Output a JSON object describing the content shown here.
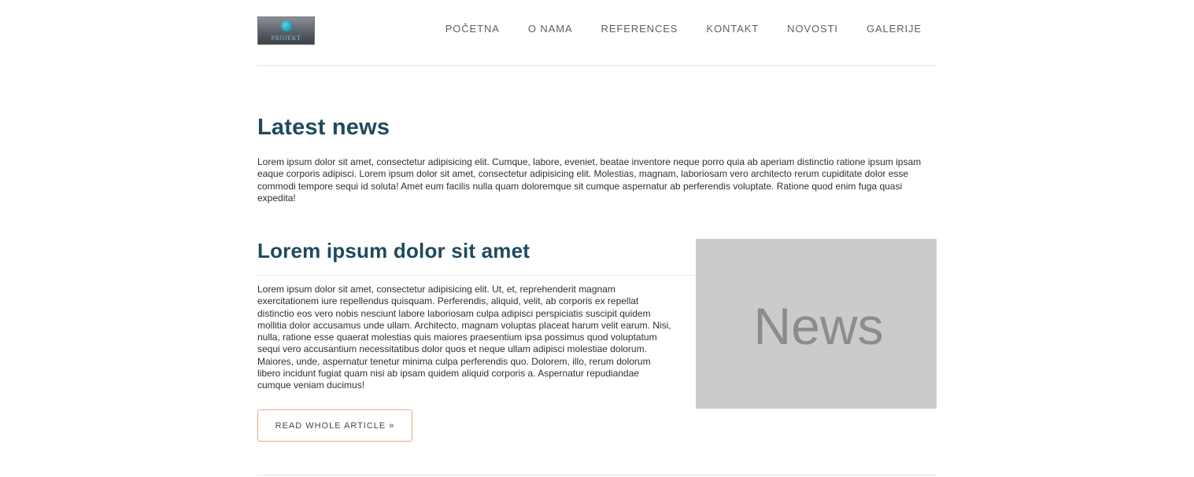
{
  "header": {
    "logo_text": "PROJEKT",
    "nav": [
      {
        "label": "POČETNA"
      },
      {
        "label": "O NAMA"
      },
      {
        "label": "REFERENCES"
      },
      {
        "label": "KONTAKT"
      },
      {
        "label": "NOVOSTI"
      },
      {
        "label": "GALERIJE"
      }
    ]
  },
  "latest": {
    "title": "Latest news",
    "intro": "Lorem ipsum dolor sit amet, consectetur adipisicing elit. Cumque, labore, eveniet, beatae inventore neque porro quia ab aperiam distinctio ratione ipsum ipsam eaque corporis adipisci. Lorem ipsum dolor sit amet, consectetur adipisicing elit. Molestias, magnam, laboriosam vero architecto rerum cupiditate dolor esse commodi tempore sequi id soluta! Amet eum facilis nulla quam doloremque sit cumque aspernatur ab perferendis voluptate. Ratione quod enim fuga quasi expedita!"
  },
  "article": {
    "title": "Lorem ipsum dolor sit amet",
    "body": "Lorem ipsum dolor sit amet, consectetur adipisicing elit. Ut, et, reprehenderit magnam exercitationem iure repellendus quisquam. Perferendis, aliquid, velit, ab corporis ex repellat distinctio eos vero nobis nesciunt labore laboriosam culpa adipisci perspiciatis suscipit quidem mollitia dolor accusamus unde ullam. Architecto, magnam voluptas placeat harum velit earum. Nisi, nulla, ratione esse quaerat molestias quis maiores praesentium ipsa possimus quod voluptatum sequi vero accusantium necessitatibus dolor quos et neque ullam adipisci molestiae dolorum. Maiores, unde, aspernatur tenetur minima culpa perferendis quo. Dolorem, illo, rerum dolorum libero incidunt fugiat quam nisi ab ipsam quidem aliquid corporis a. Aspernatur repudiandae cumque veniam ducimus!",
    "button_label": "READ WHOLE ARTICLE »",
    "image_label": "News"
  },
  "colors": {
    "heading": "#1f4a5e",
    "button_border": "#e7a88a",
    "image_placeholder": "#cbcbcb"
  }
}
